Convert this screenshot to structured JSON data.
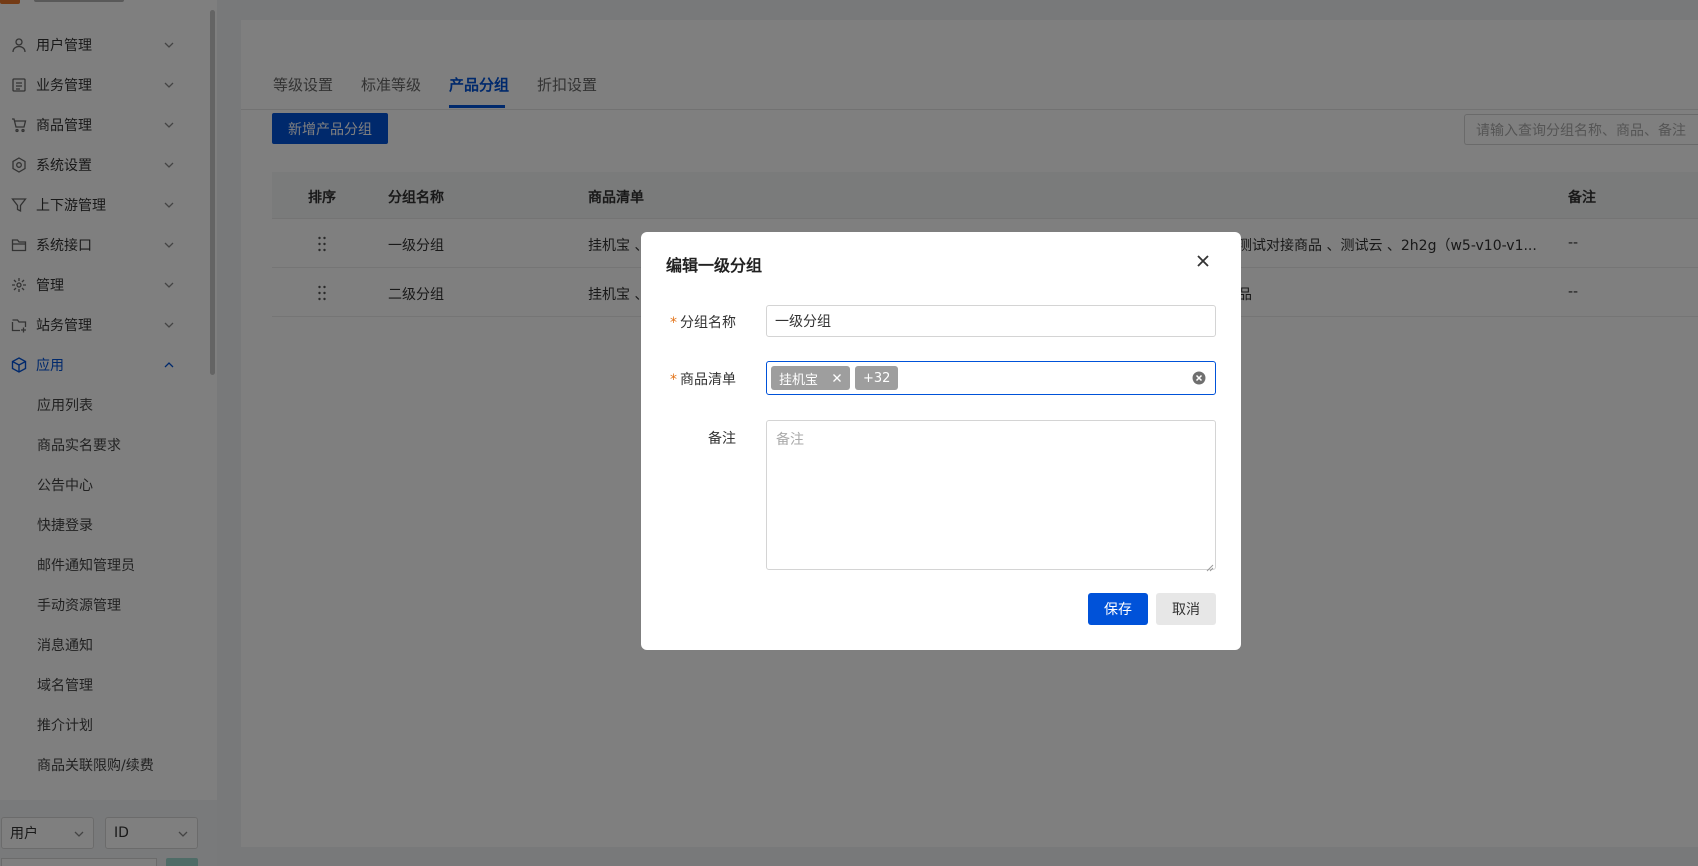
{
  "sidebar": {
    "menu": [
      {
        "label": "用户管理",
        "icon": "user-icon"
      },
      {
        "label": "业务管理",
        "icon": "list-icon"
      },
      {
        "label": "商品管理",
        "icon": "cart-icon"
      },
      {
        "label": "系统设置",
        "icon": "gear-icon"
      },
      {
        "label": "上下游管理",
        "icon": "filter-icon"
      },
      {
        "label": "系统接口",
        "icon": "folder-icon"
      },
      {
        "label": "管理",
        "icon": "sparkle-icon"
      },
      {
        "label": "站务管理",
        "icon": "folder-plus-icon"
      },
      {
        "label": "应用",
        "icon": "cube-icon",
        "expanded": true
      }
    ],
    "sub_items": [
      "应用列表",
      "商品实名要求",
      "公告中心",
      "快捷登录",
      "邮件通知管理员",
      "手动资源管理",
      "消息通知",
      "域名管理",
      "推介计划",
      "商品关联限购/续费"
    ],
    "bottom": {
      "select_type": "用户",
      "select_field": "ID"
    }
  },
  "tabs": [
    "等级设置",
    "标准等级",
    "产品分组",
    "折扣设置"
  ],
  "active_tab": "产品分组",
  "toolbar": {
    "add_label": "新增产品分组",
    "search_placeholder": "请输入查询分组名称、商品、备注"
  },
  "table": {
    "headers": {
      "sort": "排序",
      "name": "分组名称",
      "products": "商品清单",
      "remark": "备注"
    },
    "rows": [
      {
        "name": "一级分组",
        "products_left": "挂机宝 、",
        "products_right": "测试对接商品 、测试云 、2h2g（w5-v10-v1...",
        "remark": "--"
      },
      {
        "name": "二级分组",
        "products_left": "挂机宝 、",
        "products_right": "品",
        "remark": "--"
      }
    ]
  },
  "modal": {
    "title": "编辑一级分组",
    "required_mark": "*",
    "name_label": "分组名称",
    "name_value": "一级分组",
    "products_label": "商品清单",
    "tag_first": "挂机宝",
    "tag_more": "+32",
    "remark_label": "备注",
    "remark_placeholder": "备注",
    "save_label": "保存",
    "cancel_label": "取消"
  },
  "colors": {
    "primary": "#0052d9",
    "required": "#e37318",
    "tag": "#9e9e9e"
  }
}
